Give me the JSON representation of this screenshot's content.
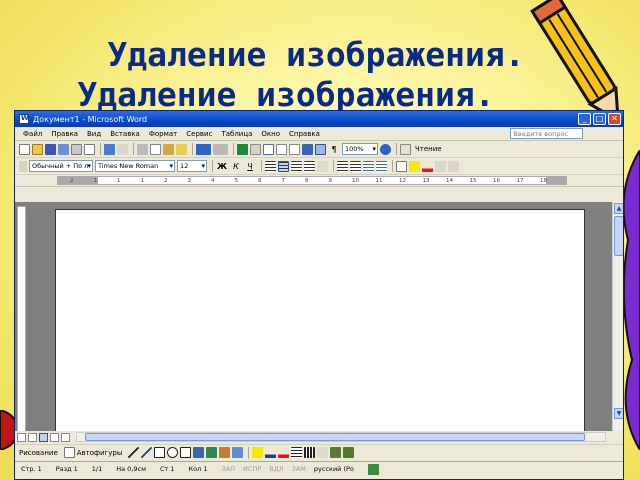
{
  "slide": {
    "title_lines": [
      "Удаление изображения.",
      "Удаление изображения."
    ]
  },
  "window": {
    "title": "Документ1 - Microsoft Word",
    "buttons": {
      "minimize": "_",
      "maximize": "□",
      "close": "✕"
    }
  },
  "menu": {
    "items": [
      "Файл",
      "Правка",
      "Вид",
      "Вставка",
      "Формат",
      "Сервис",
      "Таблица",
      "Окно",
      "Справка"
    ],
    "help_placeholder": "Введите вопрос"
  },
  "standard_toolbar": {
    "zoom": "100%",
    "read_label": "Чтение",
    "paragraph_icon": "¶"
  },
  "format_toolbar": {
    "style": "Обычный + По л",
    "font": "Times New Roman",
    "size": "12",
    "bold": "Ж",
    "italic": "К",
    "underline": "Ч"
  },
  "ruler": {
    "numbers": [
      "2",
      "1",
      "1",
      "1",
      "2",
      "3",
      "4",
      "5",
      "6",
      "7",
      "8",
      "9",
      "10",
      "11",
      "12",
      "13",
      "14",
      "15",
      "16",
      "17",
      "18"
    ]
  },
  "draw_toolbar": {
    "drawing_label": "Рисование",
    "autoshapes_label": "Автофигуры"
  },
  "status": {
    "page": "Стр. 1",
    "section": "Разд 1",
    "pages": "1/1",
    "position": "На 0,9см",
    "line": "Ст 1",
    "column": "Кол 1",
    "rec": "ЗАП",
    "trk": "ИСПР",
    "ext": "ВДЛ",
    "ovr": "ЗАМ",
    "language": "русский (Ро"
  },
  "colors": {
    "title_text": "#0a2a8a",
    "titlebar": "#0a47c8",
    "background": "#f4e66a"
  }
}
